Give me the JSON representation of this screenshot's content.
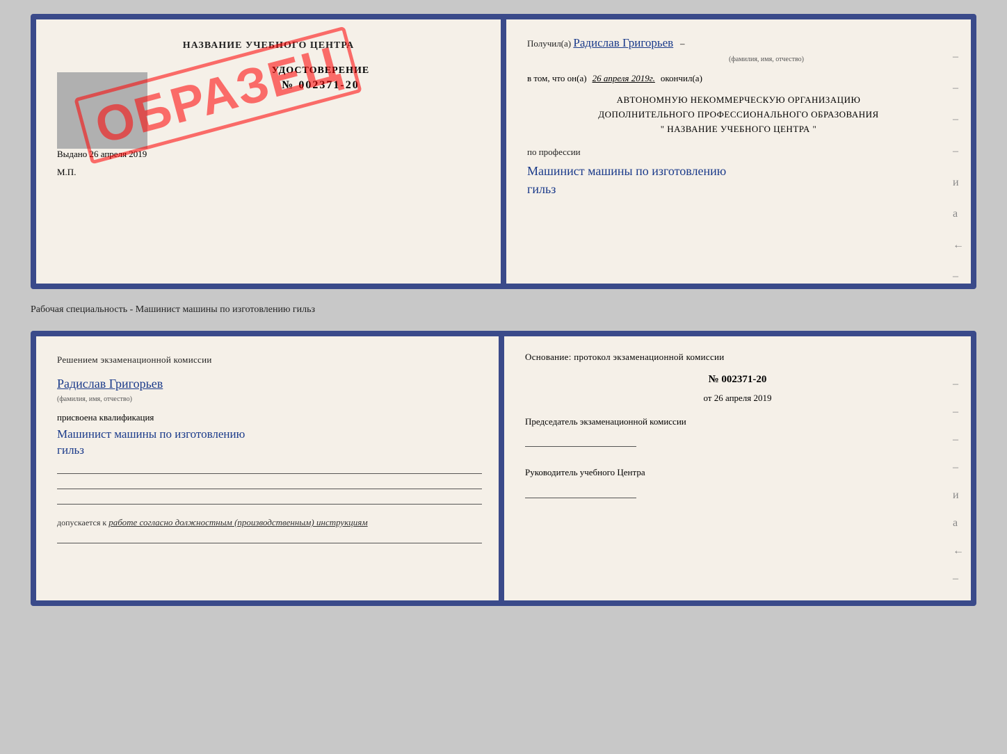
{
  "top_doc": {
    "left": {
      "center_name": "НАЗВАНИЕ УЧЕБНОГО ЦЕНТРА",
      "stamp_text": "ОБРАЗЕЦ",
      "cert_title": "УДОСТОВЕРЕНИЕ",
      "cert_number": "№ 002371-20",
      "issued_label": "Выдано",
      "issued_date": "26 апреля 2019",
      "mp_label": "М.П."
    },
    "right": {
      "received_label": "Получил(а)",
      "recipient_name": "Радислав Григорьев",
      "name_sublabel": "(фамилия, имя, отчество)",
      "completed_prefix": "в том, что он(а)",
      "completed_date": "26 апреля 2019г.",
      "completed_suffix": "окончил(а)",
      "org_line1": "АВТОНОМНУЮ НЕКОММЕРЧЕСКУЮ ОРГАНИЗАЦИЮ",
      "org_line2": "ДОПОЛНИТЕЛЬНОГО ПРОФЕССИОНАЛЬНОГО ОБРАЗОВАНИЯ",
      "org_line3": "\"  НАЗВАНИЕ УЧЕБНОГО ЦЕНТРА  \"",
      "profession_label": "по профессии",
      "profession_hw1": "Машинист машины по изготовлению",
      "profession_hw2": "гильз",
      "dashes": [
        "-",
        "-",
        "-",
        "-",
        "и",
        "а",
        "←",
        "-",
        "-"
      ]
    }
  },
  "specialty_label": "Рабочая специальность - Машинист машины по изготовлению гильз",
  "bottom_doc": {
    "left": {
      "section_title": "Решением  экзаменационной  комиссии",
      "person_name": "Радислав Григорьев",
      "name_sublabel": "(фамилия, имя, отчество)",
      "qualification_label": "присвоена квалификация",
      "qualification_hw1": "Машинист машины по изготовлению",
      "qualification_hw2": "гильз",
      "allow_prefix": "допускается к",
      "allow_hw": "работе согласно должностным (производственным) инструкциям"
    },
    "right": {
      "basis_title": "Основание:  протокол  экзаменационной  комиссии",
      "protocol_number": "№  002371-20",
      "date_prefix": "от",
      "date_value": "26 апреля 2019",
      "chairman_title": "Председатель экзаменационной комиссии",
      "head_title": "Руководитель учебного Центра",
      "dashes": [
        "-",
        "-",
        "-",
        "-",
        "и",
        "а",
        "←",
        "-",
        "-"
      ]
    }
  }
}
